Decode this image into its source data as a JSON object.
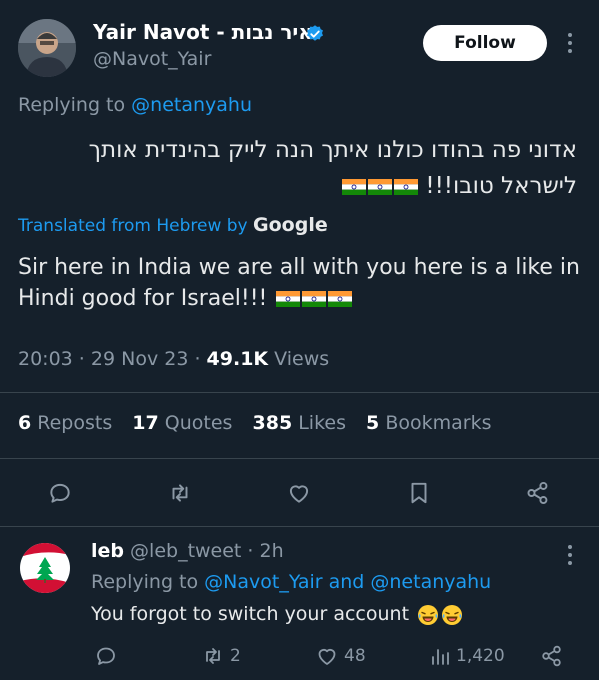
{
  "author": {
    "name_latin": "Yair Navot",
    "name_separator": " - ",
    "name_hebrew": "יאיר נבות",
    "handle": "@Navot_Yair"
  },
  "follow_label": "Follow",
  "replying": {
    "prefix": "Replying to ",
    "user": "@netanyahu"
  },
  "hebrew_text": {
    "line1": "אדוני פה בהודו כולנו איתך הנה לייק בהינדית אותך",
    "line2": "לישראל טובו!!!"
  },
  "translation_note": {
    "prefix": "Translated from Hebrew by ",
    "provider": "Google"
  },
  "translated_text": "Sir here in India we are all with you here is a like in Hindi good for Israel!!!",
  "meta": {
    "time": "20:03",
    "sep1": " · ",
    "date": "29 Nov 23",
    "sep2": " · ",
    "views_count": "49.1K",
    "views_label": " Views"
  },
  "stats": [
    {
      "count": "6",
      "label": " Reposts"
    },
    {
      "count": "17",
      "label": " Quotes"
    },
    {
      "count": "385",
      "label": " Likes"
    },
    {
      "count": "5",
      "label": " Bookmarks"
    }
  ],
  "reply": {
    "name": "leb",
    "handle": " @leb_tweet",
    "time": " · 2h",
    "replying_prefix": "Replying to ",
    "replying_user1": "@Navot_Yair",
    "replying_and": " and ",
    "replying_user2": "@netanyahu",
    "text": "You forgot to switch your account",
    "reposts": "2",
    "likes": "48",
    "views": "1,420"
  },
  "colors": {
    "background": "#15202b",
    "accent": "#1d9bf0",
    "muted": "#8b98a5",
    "divider": "#38444d"
  },
  "icons": [
    "verified-badge-icon",
    "more-icon",
    "reply-icon",
    "repost-icon",
    "like-icon",
    "bookmark-icon",
    "share-icon",
    "views-icon",
    "india-flag-icon",
    "laughing-emoji-icon",
    "lebanon-flag-avatar-icon"
  ]
}
